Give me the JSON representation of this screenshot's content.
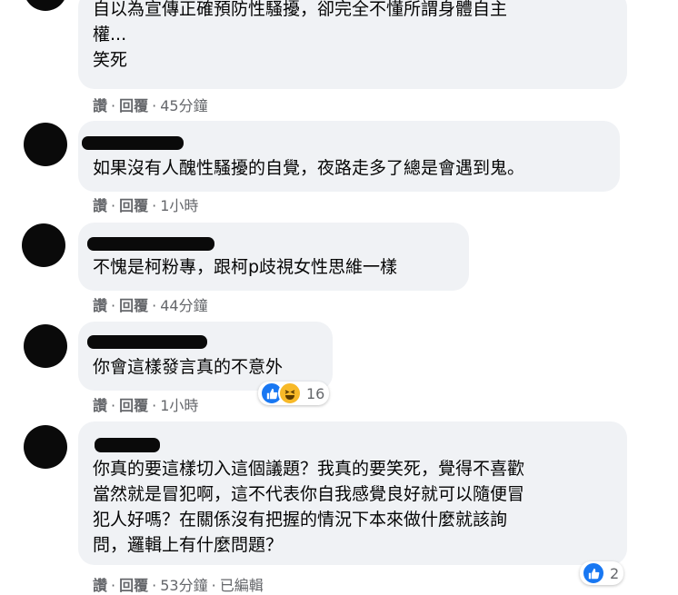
{
  "labels": {
    "like": "讚",
    "reply": "回覆",
    "edited": "已編輯"
  },
  "comments": [
    {
      "text": "自以為宣傳正確預防性騷擾，卻完全不懂所謂身體自主\n權...\n笑死",
      "time": "45分鐘"
    },
    {
      "text": "如果沒有人醜性騷擾的自覺，夜路走多了總是會遇到鬼。",
      "time": "1小時"
    },
    {
      "text": "不愧是柯粉專，跟柯p歧視女性思維一樣",
      "time": "44分鐘"
    },
    {
      "text": "你會這樣發言真的不意外",
      "time": "1小時",
      "reaction_count": "16",
      "reactions": [
        "like-icon",
        "haha-icon"
      ]
    },
    {
      "text": "你真的要這樣切入這個議題？我真的要笑死，覺得不喜歡\n當然就是冒犯啊，這不代表你自我感覺良好就可以隨便冒\n犯人好嗎？在關係沒有把握的情況下本來做什麼就該詢\n問，邏輯上有什麼問題？",
      "time": "53分鐘",
      "reaction_count": "2",
      "reactions": [
        "like-icon"
      ]
    }
  ],
  "colors": {
    "bubble": "#f0f2f5",
    "meta": "#65676b",
    "like": "#1877f2",
    "haha": "#f7b928"
  }
}
